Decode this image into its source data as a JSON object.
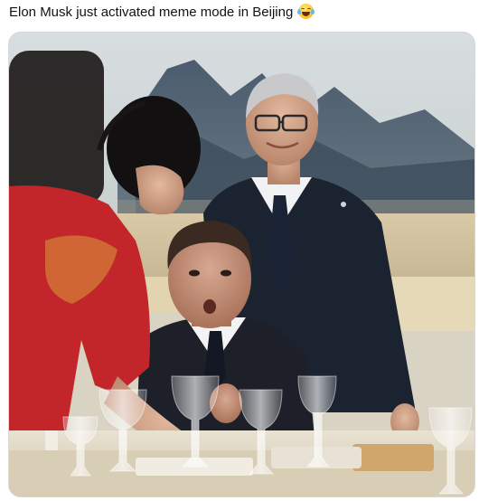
{
  "post": {
    "text": "Elon Musk just activated meme mode in Beijing",
    "emoji_icon": "face-with-tears-of-joy-icon"
  },
  "media": {
    "type": "photo"
  },
  "colors": {
    "text": "#0f1419",
    "border": "#cfd9de",
    "background": "#ffffff"
  }
}
